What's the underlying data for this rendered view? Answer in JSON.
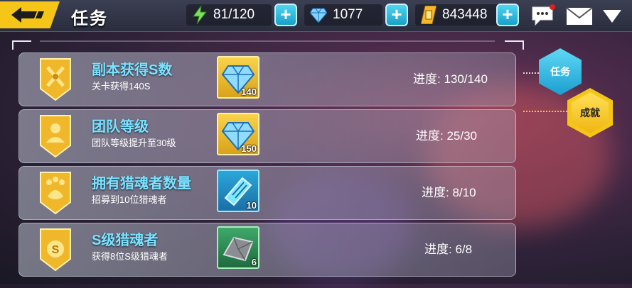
{
  "header": {
    "title": "任务",
    "stamina": "81/120",
    "diamonds": "1077",
    "coins": "843448",
    "plus_label": "+"
  },
  "side_tabs": [
    {
      "label": "任务"
    },
    {
      "label": "成就"
    }
  ],
  "achievements": [
    {
      "title": "副本获得S数",
      "desc": "关卡获得140S",
      "reward_icon": "diamond-icon",
      "reward_count": "140",
      "progress": "进度: 130/140"
    },
    {
      "title": "团队等级",
      "desc": "团队等级提升至30级",
      "reward_icon": "diamond-icon",
      "reward_count": "150",
      "progress": "进度: 25/30"
    },
    {
      "title": "拥有猎魂者数量",
      "desc": "招募到10位猎魂者",
      "reward_icon": "ticket-icon",
      "reward_count": "10",
      "progress": "进度: 8/10"
    },
    {
      "title": "S级猎魂者",
      "desc": "获得8位S级猎魂者",
      "reward_icon": "iron-ingot-icon",
      "reward_count": "6",
      "progress": "进度: 6/8"
    }
  ],
  "colors": {
    "accent_yellow": "#f5c518",
    "accent_cyan": "#4fd6f0",
    "title_cyan": "#7be3ff"
  }
}
